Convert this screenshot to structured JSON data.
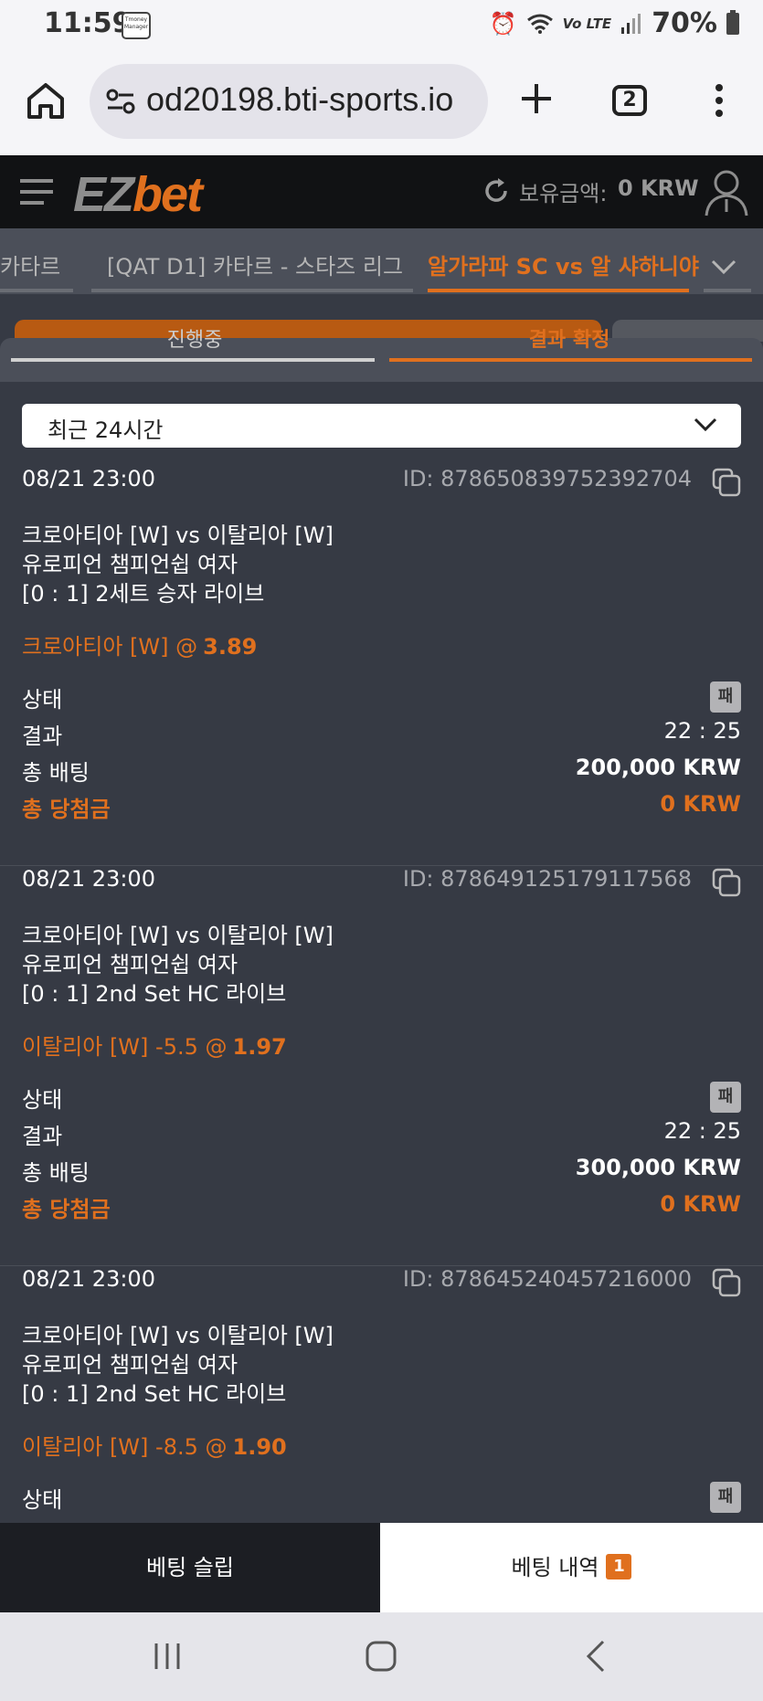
{
  "status_bar": {
    "time": "11:59",
    "notification": "Tmoney\nManager",
    "lte": "Vo LTE",
    "battery": "70%"
  },
  "browser": {
    "url": "od20198.bti-sports.io",
    "tab_count": "2"
  },
  "app_header": {
    "logo_part1": "EZ",
    "logo_part2": "bet",
    "balance_label": "보유금액:",
    "balance_value": "0 KRW"
  },
  "breadcrumbs": [
    {
      "label": "카타르"
    },
    {
      "label": "[QAT D1] 카타르 - 스타즈 리그"
    },
    {
      "label": "알가라파 SC vs 알 샤하니야"
    }
  ],
  "sub_tabs": [
    {
      "label": "진행중"
    },
    {
      "label": "결과 확정"
    }
  ],
  "filter": {
    "value": "최근 24시간"
  },
  "labels": {
    "status": "상태",
    "result": "결과",
    "total_bet": "총 배팅",
    "total_win": "총 당첨금",
    "at": "@"
  },
  "bets": [
    {
      "date": "08/21 23:00",
      "id": "ID: 878650839752392704",
      "match": "크로아티아 [W] vs 이탈리아 [W]",
      "league": "유로피언 챔피언쉽 여자",
      "market": "[0 : 1] 2세트 승자 라이브",
      "selection": "크로아티아 [W]",
      "odds": "3.89",
      "status": "패",
      "result": "22 : 25",
      "stake": "200,000 KRW",
      "winnings": "0 KRW"
    },
    {
      "date": "08/21 23:00",
      "id": "ID: 878649125179117568",
      "match": "크로아티아 [W] vs 이탈리아 [W]",
      "league": "유로피언 챔피언쉽 여자",
      "market": "[0 : 1] 2nd Set HC 라이브",
      "selection": "이탈리아 [W] -5.5",
      "odds": "1.97",
      "status": "패",
      "result": "22 : 25",
      "stake": "300,000 KRW",
      "winnings": "0 KRW"
    },
    {
      "date": "08/21 23:00",
      "id": "ID: 878645240457216000",
      "match": "크로아티아 [W] vs 이탈리아 [W]",
      "league": "유로피언 챔피언쉽 여자",
      "market": "[0 : 1] 2nd Set HC 라이브",
      "selection": "이탈리아 [W] -8.5",
      "odds": "1.90",
      "status": "패"
    }
  ],
  "bottom_tabs": {
    "slip": "베팅 슬립",
    "history": "베팅 내역",
    "history_count": "1"
  },
  "colors": {
    "accent": "#e0701e",
    "background": "#363a44",
    "header": "#111214"
  }
}
